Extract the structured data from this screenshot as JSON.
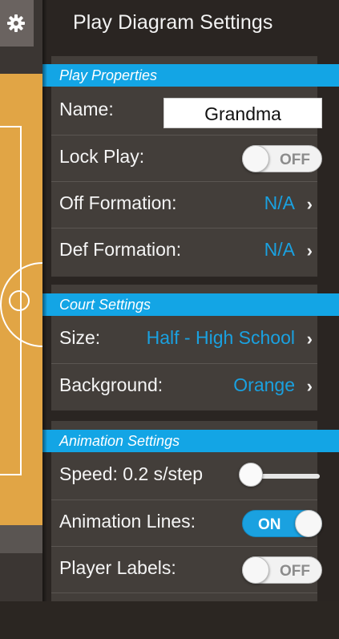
{
  "header": {
    "title": "Play Diagram Settings",
    "settings_icon": "gear-icon"
  },
  "sidebar": {
    "court_background_color": "#e1a545"
  },
  "sections": {
    "play_properties": {
      "title": "Play Properties",
      "name_label": "Name:",
      "name_value": "Grandma",
      "lock_label": "Lock Play:",
      "lock_state": "OFF",
      "off_formation_label": "Off Formation:",
      "off_formation_value": "N/A",
      "def_formation_label": "Def Formation:",
      "def_formation_value": "N/A"
    },
    "court_settings": {
      "title": "Court Settings",
      "size_label": "Size:",
      "size_value": "Half - High School",
      "background_label": "Background:",
      "background_value": "Orange"
    },
    "animation_settings": {
      "title": "Animation Settings",
      "speed_label": "Speed: 0.2 s/step",
      "speed_slider_fraction": 0.0,
      "animation_lines_label": "Animation Lines:",
      "animation_lines_state": "ON",
      "player_labels_label": "Player Labels:",
      "player_labels_state": "OFF"
    }
  },
  "colors": {
    "accent": "#1aa1e0",
    "section_bar": "#13a5e5",
    "panel": "#2a2522",
    "row": "#433e3a"
  }
}
